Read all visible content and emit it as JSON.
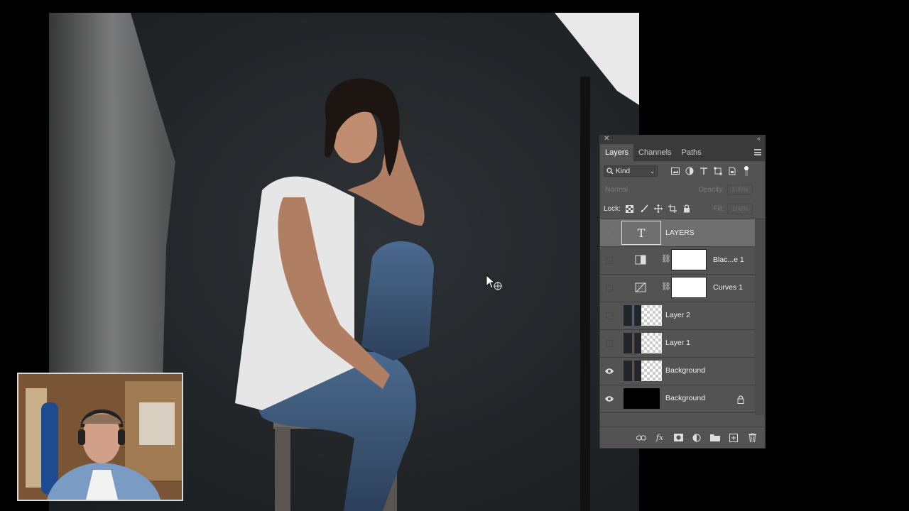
{
  "panel": {
    "tabs": [
      {
        "label": "Layers"
      },
      {
        "label": "Channels"
      },
      {
        "label": "Paths"
      }
    ],
    "filter": {
      "kind_label": "Kind"
    },
    "blend_mode": "Normal",
    "opacity_label": "Opacity:",
    "opacity_value": "100%",
    "lock_label": "Lock:",
    "fill_label": "Fill:",
    "fill_value": "100%",
    "layers": [
      {
        "name": "LAYERS",
        "type": "text",
        "visible": false,
        "selected": true
      },
      {
        "name": "Blac...e 1",
        "type": "adjustment-black-white",
        "visible": false
      },
      {
        "name": "Curves 1",
        "type": "adjustment-curves",
        "visible": false
      },
      {
        "name": "Layer 2",
        "type": "pixel",
        "visible": false
      },
      {
        "name": "Layer 1",
        "type": "pixel",
        "visible": false
      },
      {
        "name": "Background",
        "type": "pixel",
        "visible": true
      },
      {
        "name": "Background",
        "type": "background",
        "visible": true,
        "locked": true
      }
    ]
  },
  "icons": {
    "close": "close-icon",
    "collapse": "collapse-icon",
    "panel_menu": "hamburger-menu-icon",
    "search": "search-icon",
    "filter_pixel": "image-icon",
    "filter_adjustment": "half-circle-icon",
    "filter_type": "type-icon",
    "filter_shape": "shape-icon",
    "filter_smart": "smart-object-icon",
    "filter_toggle": "toggle-icon",
    "lock_transparent": "checkerboard-icon",
    "lock_paint": "brush-icon",
    "lock_move": "move-icon",
    "lock_artboard": "artboard-icon",
    "lock_all": "lock-icon",
    "link": "link-icon",
    "fx": "fx-icon",
    "mask": "mask-icon",
    "new_adjustment": "adjustment-icon",
    "group": "folder-icon",
    "new_layer": "new-layer-icon",
    "delete": "trash-icon"
  },
  "colors": {
    "panel_bg": "#535353",
    "panel_dark": "#3a3a3a",
    "selected_row": "#6f6f6f"
  }
}
